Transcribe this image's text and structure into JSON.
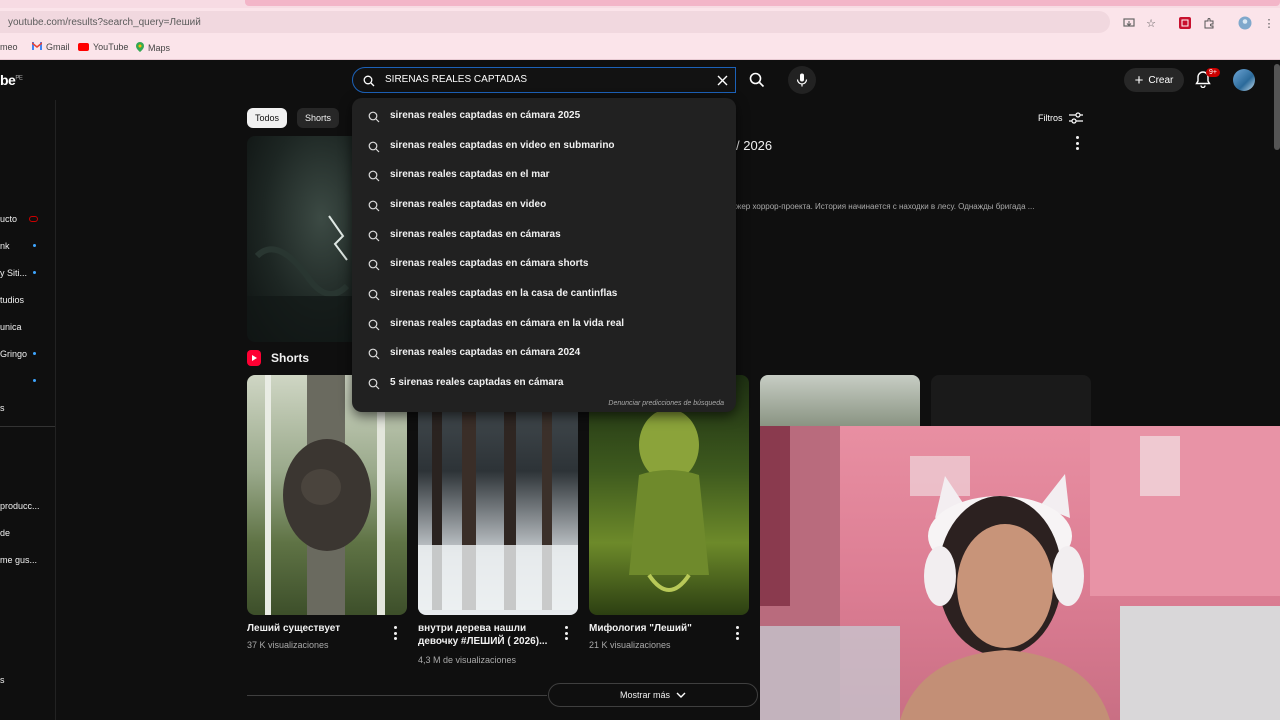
{
  "browser": {
    "url": "youtube.com/results?search_query=Леший",
    "bookmarks": [
      "meo",
      "Gmail",
      "YouTube",
      "Maps"
    ]
  },
  "header": {
    "logo": "be",
    "logo_region": "PE",
    "search_value": "SIRENAS REALES CAPTADAS",
    "create_label": "Crear",
    "notification_count": "9+"
  },
  "sidebar": {
    "items": [
      "ucto",
      "nk",
      "y Siti...",
      "tudios",
      "unica",
      "Gringo",
      "s",
      "producc...",
      "de",
      "me gus...",
      "s"
    ]
  },
  "chips": {
    "all": "Todos",
    "shorts": "Shorts",
    "filters": "Filtros"
  },
  "main_video": {
    "title_tail": "/ 2026",
    "description": "жер хоррор-проекта. История начинается с находки в лесу. Однажды бригада ..."
  },
  "suggestions": {
    "items": [
      "sirenas reales captadas en cámara 2025",
      "sirenas reales captadas en video en submarino",
      "sirenas reales captadas en el mar",
      "sirenas reales captadas en video",
      "sirenas reales captadas en cámaras",
      "sirenas reales captadas en cámara shorts",
      "sirenas reales captadas en la casa de cantinflas",
      "sirenas reales captadas en cámara en la vida real",
      "sirenas reales captadas en cámara 2024",
      "5 sirenas reales captadas en cámara"
    ],
    "report": "Denunciar predicciones de búsqueda"
  },
  "shorts": {
    "heading": "Shorts",
    "items": [
      {
        "title": "Леший существует",
        "views": "37 K visualizaciones"
      },
      {
        "title": "внутри дерева нашли девочку #ЛЕШИЙ ( 2026)...",
        "views": "4,3 M de visualizaciones"
      },
      {
        "title": "Мифология \"Леший\"",
        "views": "21 K visualizaciones"
      }
    ],
    "more_label": "Mostrar más"
  },
  "colors": {
    "background": "#0f0f0f",
    "search_border": "#1c62b9",
    "shorts_red": "#ff0033",
    "badge_red": "#cc0000"
  }
}
